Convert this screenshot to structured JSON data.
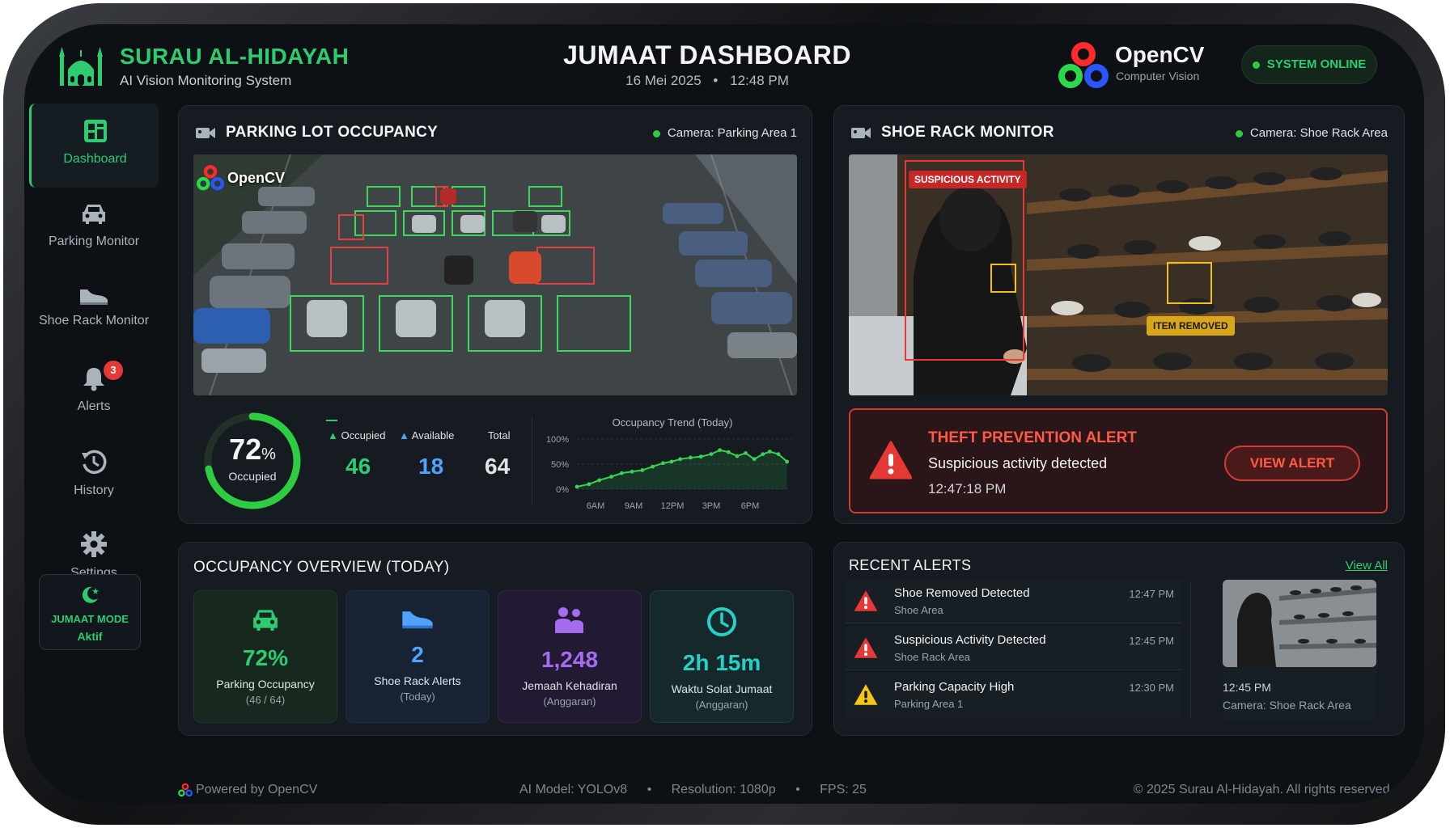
{
  "header": {
    "org_name": "SURAU AL-HIDAYAH",
    "org_subtitle": "AI Vision Monitoring System",
    "dashboard_title": "JUMAAT DASHBOARD",
    "date": "16 Mei 2025",
    "separator": "•",
    "time": "12:48 PM",
    "brand_name": "OpenCV",
    "brand_subtitle": "Computer Vision",
    "status": "SYSTEM ONLINE"
  },
  "sidebar": {
    "items": [
      {
        "label": "Dashboard",
        "icon": "dashboard-icon"
      },
      {
        "label": "Parking Monitor",
        "icon": "car-icon"
      },
      {
        "label": "Shoe Rack Monitor",
        "icon": "shoe-icon"
      },
      {
        "label": "Alerts",
        "icon": "bell-icon",
        "badge": "3"
      },
      {
        "label": "History",
        "icon": "history-icon"
      },
      {
        "label": "Settings",
        "icon": "gear-icon"
      }
    ],
    "mode_title": "JUMAAT MODE",
    "mode_status": "Aktif"
  },
  "parking": {
    "title": "PARKING LOT OCCUPANCY",
    "camera": "Camera: Parking Area 1",
    "overlay_brand": "OpenCV",
    "gauge_value": "72",
    "gauge_unit": "%",
    "gauge_fraction": 0.72,
    "gauge_label": "Occupied",
    "occupied_label": "Occupied",
    "available_label": "Available",
    "total_label": "Total",
    "occupied_value": "46",
    "available_value": "18",
    "total_value": "64",
    "trend_title": "Occupancy Trend (Today)"
  },
  "chart_data": {
    "type": "area",
    "title": "Occupancy Trend (Today)",
    "x_ticks": [
      "6AM",
      "9AM",
      "12PM",
      "3PM",
      "6PM"
    ],
    "y_ticks": [
      "100%",
      "50%",
      "0%"
    ],
    "ylim": [
      0,
      100
    ],
    "xlim": [
      6,
      18.5
    ],
    "x": [
      6,
      6.7,
      7.3,
      8,
      8.6,
      9.2,
      9.8,
      10.4,
      11,
      11.5,
      12,
      12.6,
      13.2,
      13.8,
      14.3,
      14.8,
      15.3,
      15.8,
      16.3,
      16.8,
      17.2,
      17.7,
      18.2
    ],
    "values": [
      5,
      10,
      18,
      25,
      32,
      35,
      38,
      45,
      52,
      55,
      60,
      63,
      65,
      70,
      78,
      74,
      66,
      72,
      60,
      70,
      75,
      70,
      55
    ],
    "grid": true,
    "color": "#39d353"
  },
  "shoe": {
    "title": "SHOE RACK MONITOR",
    "camera": "Camera: Shoe Rack Area",
    "tag_suspicious": "SUSPICIOUS ACTIVITY",
    "tag_removed": "ITEM REMOVED",
    "alert_title": "THEFT PREVENTION ALERT",
    "alert_desc": "Suspicious activity detected",
    "alert_time": "12:47:18 PM",
    "alert_button": "VIEW ALERT"
  },
  "overview": {
    "title": "OCCUPANCY OVERVIEW (TODAY)",
    "tiles": [
      {
        "value": "72%",
        "label": "Parking Occupancy",
        "sub": "(46 / 64)",
        "icon": "car-icon",
        "color": "#2ecc71"
      },
      {
        "value": "2",
        "label": "Shoe Rack Alerts",
        "sub": "(Today)",
        "icon": "shoe-icon",
        "color": "#4fa3ff"
      },
      {
        "value": "1,248",
        "label": "Jemaah Kehadiran",
        "sub": "(Anggaran)",
        "icon": "people-icon",
        "color": "#a66cf0"
      },
      {
        "value": "2h 15m",
        "label": "Waktu Solat Jumaat",
        "sub": "(Anggaran)",
        "icon": "clock-icon",
        "color": "#26d0c9"
      }
    ]
  },
  "recent": {
    "title": "RECENT ALERTS",
    "view_all": "View All",
    "items": [
      {
        "title": "Shoe Removed Detected",
        "location": "Shoe Area",
        "time": "12:47 PM",
        "level": "critical"
      },
      {
        "title": "Suspicious Activity Detected",
        "location": "Shoe Rack Area",
        "time": "12:45 PM",
        "level": "critical"
      },
      {
        "title": "Parking Capacity High",
        "location": "Parking Area 1",
        "time": "12:30 PM",
        "level": "warning"
      }
    ],
    "thumb_time": "12:45 PM",
    "thumb_camera": "Camera: Shoe Rack Area"
  },
  "footer": {
    "powered": "Powered by OpenCV",
    "model": "AI Model: YOLOv8",
    "resolution": "Resolution: 1080p",
    "fps": "FPS: 25",
    "copyright": "© 2025 Surau Al-Hidayah. All rights reserved."
  }
}
